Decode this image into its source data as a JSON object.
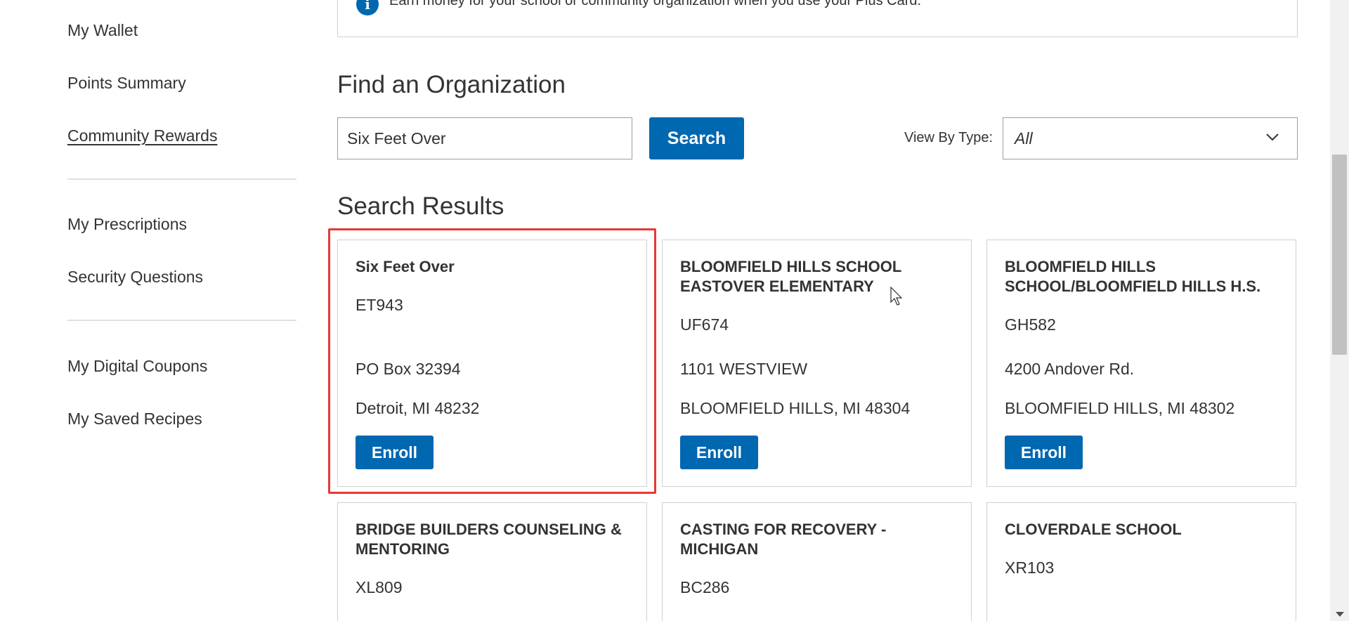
{
  "sidebar": {
    "items": [
      {
        "label": "My Wallet"
      },
      {
        "label": "Points Summary"
      },
      {
        "label": "Community Rewards",
        "active": true
      },
      {
        "label": "My Prescriptions"
      },
      {
        "label": "Security Questions"
      },
      {
        "label": "My Digital Coupons"
      },
      {
        "label": "My Saved Recipes"
      }
    ]
  },
  "info": {
    "icon": "info-icon",
    "icon_glyph": "i",
    "text": "Earn money for your school or community organization when you use your Plus Card."
  },
  "find": {
    "title": "Find an Organization",
    "search_value": "Six Feet Over",
    "search_button": "Search",
    "type_label": "View By Type:",
    "type_value": "All"
  },
  "results": {
    "title": "Search Results",
    "enroll_label": "Enroll",
    "cards": [
      {
        "name": "Six Feet Over",
        "code": "ET943",
        "addr1": "PO Box 32394",
        "addr2": "Detroit, MI 48232"
      },
      {
        "name": "BLOOMFIELD HILLS SCHOOL EASTOVER ELEMENTARY",
        "code": "UF674",
        "addr1": "1101 WESTVIEW",
        "addr2": "BLOOMFIELD HILLS, MI 48304"
      },
      {
        "name": "BLOOMFIELD HILLS SCHOOL/BLOOMFIELD HILLS H.S.",
        "code": "GH582",
        "addr1": "4200 Andover Rd.",
        "addr2": "BLOOMFIELD HILLS, MI 48302"
      },
      {
        "name": "BRIDGE BUILDERS COUNSELING & MENTORING",
        "code": "XL809"
      },
      {
        "name": "CASTING FOR RECOVERY - MICHIGAN",
        "code": "BC286"
      },
      {
        "name": "CLOVERDALE SCHOOL",
        "code": "XR103"
      }
    ]
  },
  "colors": {
    "accent": "#0067b1",
    "highlight": "#e53935",
    "text": "#333333"
  }
}
